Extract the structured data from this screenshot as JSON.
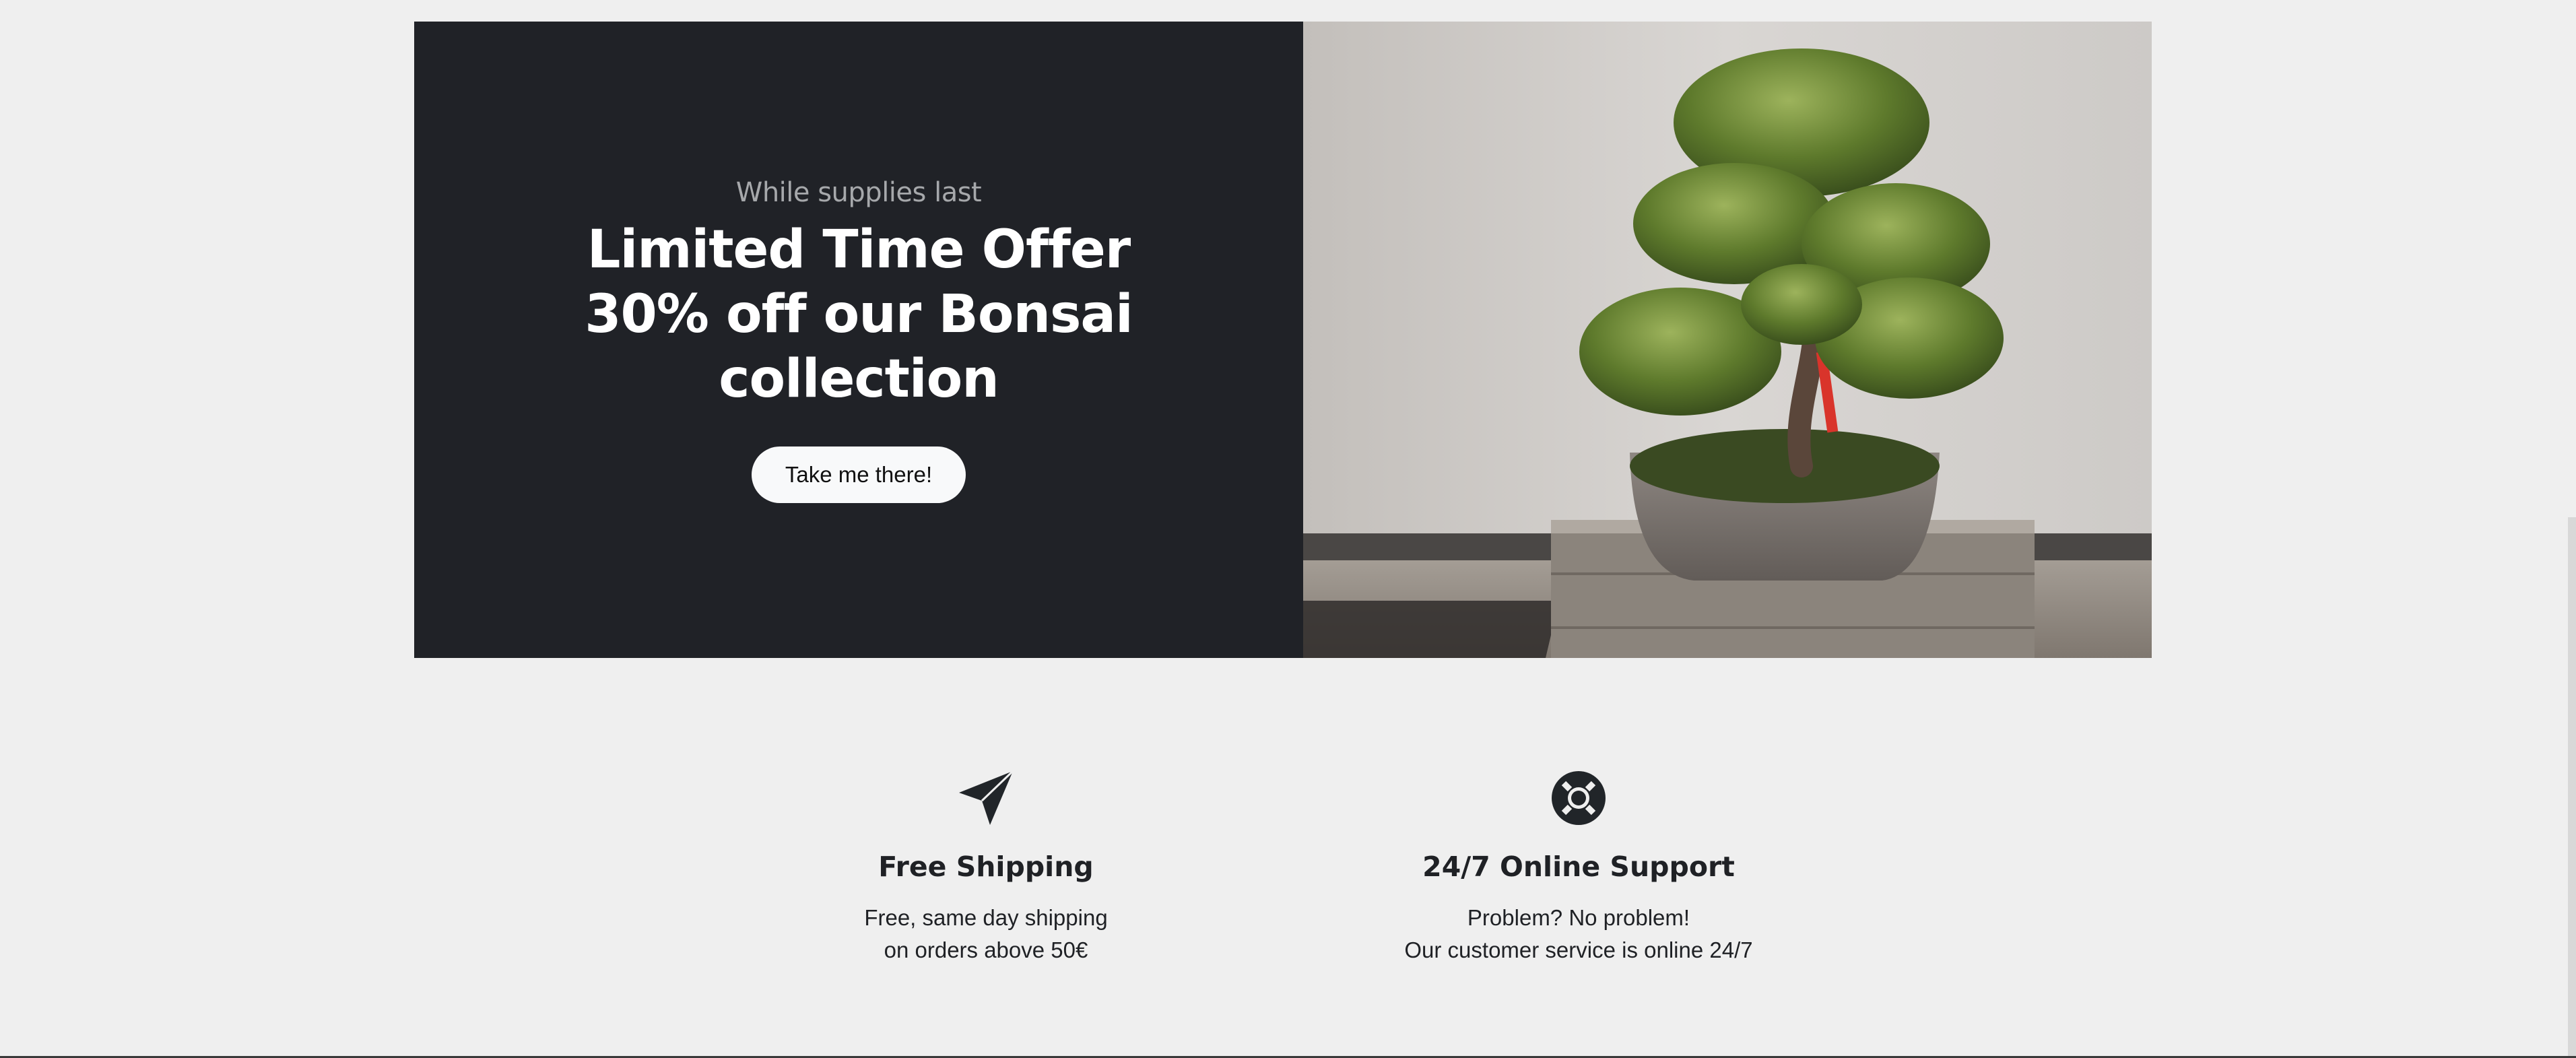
{
  "promo": {
    "eyebrow": "While supplies last",
    "headline": "Limited Time Offer 30% off our Bonsai collection",
    "cta_label": "Take me there!",
    "image_alt": "bonsai tree photo"
  },
  "features": [
    {
      "icon": "send-icon",
      "title": "Free Shipping",
      "line1": "Free, same day shipping",
      "line2": "on orders above 50€"
    },
    {
      "icon": "lifebuoy-icon",
      "title": "24/7 Online Support",
      "line1": "Problem? No problem!",
      "line2": "Our customer service is online 24/7"
    }
  ],
  "colors": {
    "dark_panel": "#202227",
    "page_background": "#efefef",
    "button_background": "#f8f9fa"
  }
}
